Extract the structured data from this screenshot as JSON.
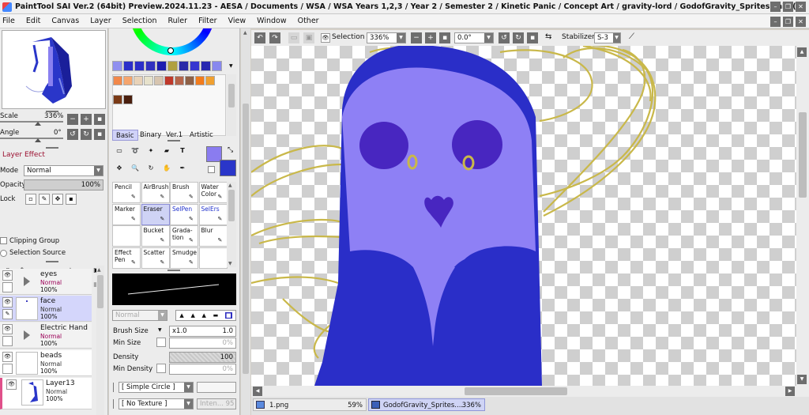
{
  "title": "PaintTool SAI Ver.2 (64bit) Preview.2024.11.23 - AESA / Documents / WSA / WSA Years 1,2,3 / Year 2 / Semester 2 / Kinetic Panic / Concept Art / gravity-lord / GodofGravity_Sprites.sai2 (*)",
  "menu": [
    "File",
    "Edit",
    "Canvas",
    "Layer",
    "Selection",
    "Ruler",
    "Filter",
    "View",
    "Window",
    "Other"
  ],
  "navigator": {
    "scale_label": "Scale",
    "scale_value": "336%",
    "angle_label": "Angle",
    "angle_value": "0°"
  },
  "layer_effect": {
    "header": "Layer Effect",
    "mode_label": "Mode",
    "mode_value": "Normal",
    "opacity_label": "Opacity",
    "opacity_value": "100%",
    "lock_label": "Lock",
    "clipping_group": "Clipping Group",
    "selection_source": "Selection Source"
  },
  "layers": [
    {
      "name": "eyes",
      "mode": "Normal",
      "opacity": "100%",
      "folder": true,
      "mode_colored": true
    },
    {
      "name": "face",
      "mode": "Normal",
      "opacity": "100%",
      "folder": false,
      "mode_colored": false
    },
    {
      "name": "Electric Hand",
      "mode": "Normal",
      "opacity": "100%",
      "folder": true,
      "mode_colored": true
    },
    {
      "name": "beads",
      "mode": "Normal",
      "opacity": "100%",
      "folder": false,
      "mode_colored": false
    },
    {
      "name": "Layer13",
      "mode": "Normal",
      "opacity": "100%",
      "folder": false,
      "mode_colored": false
    }
  ],
  "colors": {
    "primary": "#8a7cf0",
    "secondary": "#2a36c9",
    "ghost_dark": "#2a2ec8",
    "ghost_light": "#8e80f5",
    "eye_socket": "#4826c0",
    "scribble": "#c9b84a",
    "palette_row1": [
      "#8f8ff0",
      "#2b2ec9",
      "#2b2ec9",
      "#3030c0",
      "#1c1cb0",
      "#b0a040",
      "#2a2aa8",
      "#3535d0",
      "#2626b0",
      "#8888ee"
    ],
    "palette_row2": [
      "#f2884a",
      "#f5a56e",
      "#e8d2b8",
      "#e7e2cc",
      "#d7c5b0",
      "#c0392b",
      "#b5654b",
      "#8e6046",
      "#f27c1c",
      "#f0a030"
    ],
    "palette_row3": [
      "#7a3a16",
      "#4a1f0e"
    ]
  },
  "tool_tabs": [
    "Basic",
    "Binary",
    "Ver.1",
    "Artistic"
  ],
  "tools": [
    {
      "name": "Pencil",
      "color": "#111"
    },
    {
      "name": "AirBrush",
      "color": "#111"
    },
    {
      "name": "Brush",
      "color": "#111"
    },
    {
      "name": "Water Color",
      "color": "#111"
    },
    {
      "name": "Marker",
      "color": "#111"
    },
    {
      "name": "Eraser",
      "color": "#111",
      "selected": true
    },
    {
      "name": "SelPen",
      "color": "#2233cc"
    },
    {
      "name": "SelErs",
      "color": "#2233cc"
    },
    {
      "name": "",
      "color": "#111"
    },
    {
      "name": "Bucket",
      "color": "#111"
    },
    {
      "name": "Grada-tion",
      "color": "#111"
    },
    {
      "name": "Blur",
      "color": "#111"
    },
    {
      "name": "Effect Pen",
      "color": "#111"
    },
    {
      "name": "Scatter",
      "color": "#111"
    },
    {
      "name": "Smudge",
      "color": "#111"
    },
    {
      "name": "",
      "color": "#111"
    }
  ],
  "brush": {
    "blend_mode": "Normal",
    "size_label": "Brush Size",
    "size_mult": "x1.0",
    "size_value": "1.0",
    "min_size_label": "Min Size",
    "min_size_value": "0%",
    "density_label": "Density",
    "density_value": "100",
    "min_density_label": "Min Density",
    "min_density_value": "0%",
    "shape": "[ Simple Circle ]",
    "texture": "[ No Texture ]",
    "texture_intensity": "Inten... 95"
  },
  "toolbar": {
    "selection_label": "Selection",
    "zoom": "336%",
    "angle": "0.0°",
    "stabilizer_label": "Stabilizer",
    "stabilizer_value": "S-3"
  },
  "documents": [
    {
      "name": "1.png",
      "zoom": "59%"
    },
    {
      "name": "GodofGravity_Sprites....",
      "zoom": "336%"
    }
  ]
}
